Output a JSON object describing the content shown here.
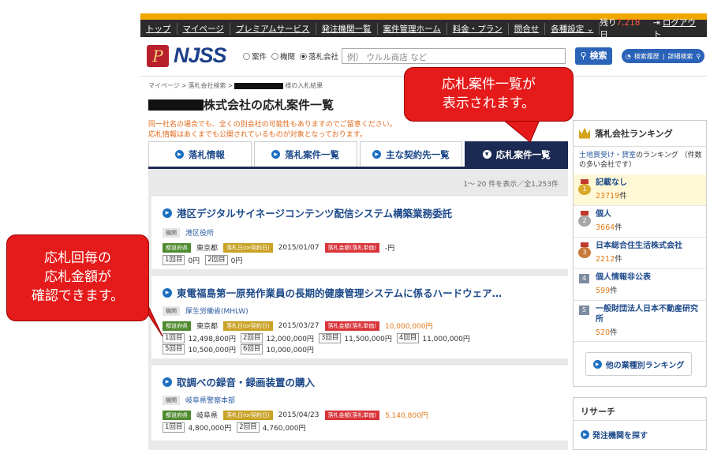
{
  "nav": {
    "items": [
      "トップ",
      "マイページ",
      "プレミアムサービス",
      "発注機関一覧",
      "案件管理ホーム",
      "料金・プラン",
      "問合せ",
      "各種設定 ⌄"
    ],
    "days_prefix": "残り",
    "days_value": "7,218",
    "days_suffix": "日",
    "logout": "ログアウト"
  },
  "brand": {
    "mark": "P",
    "name": "NJSS"
  },
  "search": {
    "options": [
      "案件",
      "機関",
      "落札会社"
    ],
    "selected": "落札会社",
    "placeholder": "例） ウルル商店 など",
    "button": "検索",
    "history": "検索履歴",
    "advanced": "詳細検索"
  },
  "breadcrumb": {
    "home": "マイページ",
    "sep": ">",
    "search": "落札会社検索",
    "suffix": "様の入札結果"
  },
  "page_title_suffix": "株式会社の応札案件一覧",
  "notice": [
    "同一社名の場合でも、全くの別会社の可能性もありますのでご留意ください。",
    "応札情報はあくまでも公開されているものが対象となっております。"
  ],
  "tabs": [
    "落札情報",
    "落札案件一覧",
    "主な契約先一覧",
    "応札案件一覧"
  ],
  "active_tab": "応札案件一覧",
  "pager": "1～ 20 件を表示／全1,253件",
  "tag_labels": {
    "agency": "機関",
    "pref": "都道府県",
    "date": "落札日(or契約日)",
    "amount": "落札金額(落札単価)"
  },
  "bid_round_suffix": "回目",
  "cases": [
    {
      "title": "港区デジタルサイネージコンテンツ配信システム構築業務委託",
      "agency": "港区役所",
      "pref": "東京都",
      "date": "2015/01/07",
      "amount": "-円",
      "bids": [
        [
          "1",
          "0円"
        ],
        [
          "2",
          "0円"
        ]
      ]
    },
    {
      "title": "東電福島第一原発作業員の長期的健康管理システムに係るハードウェア…",
      "agency": "厚生労働省(MHLW)",
      "pref": "東京都",
      "date": "2015/03/27",
      "amount": "10,000,000円",
      "bids": [
        [
          "1",
          "12,498,800円"
        ],
        [
          "2",
          "12,000,000円"
        ],
        [
          "3",
          "11,500,000円"
        ],
        [
          "4",
          "11,000,000円"
        ],
        [
          "5",
          "10,500,000円"
        ],
        [
          "6",
          "10,000,000円"
        ]
      ]
    },
    {
      "title": "取調べの録音・録画装置の購入",
      "agency": "岐阜県警察本部",
      "pref": "岐阜県",
      "date": "2015/04/23",
      "amount": "5,140,800円",
      "bids": [
        [
          "1",
          "4,800,000円"
        ],
        [
          "2",
          "4,760,000円"
        ]
      ]
    }
  ],
  "sidebar": {
    "title": "落札会社ランキング",
    "desc_link": "土地買受け・貸室",
    "desc_rest": "のランキング （件数の多い会社です）",
    "count_suffix": "件",
    "ranking": [
      {
        "rank": "1",
        "name": "記載なし",
        "count": "23719"
      },
      {
        "rank": "2",
        "name": "個人",
        "count": "3664"
      },
      {
        "rank": "3",
        "name": "日本総合住生活株式会社",
        "count": "2212"
      },
      {
        "rank": "4",
        "name": "個人情報非公表",
        "count": "599"
      },
      {
        "rank": "5",
        "name": "一般財団法人日本不動産研究所",
        "count": "520"
      }
    ],
    "more_button": "他の業種別ランキング",
    "research_title": "リサーチ",
    "research_link": "発注機関を探す"
  },
  "callouts": {
    "right": [
      "応札案件一覧が",
      "表示されます。"
    ],
    "left": [
      "応札回毎の",
      "応札金額が",
      "確認できます。"
    ]
  },
  "colors": {
    "accent": "#2a63b8",
    "nav_bg": "#2b2b2b",
    "orange": "#f0a800",
    "callout": "#e51a1a",
    "active_tab": "#1b2a52"
  }
}
